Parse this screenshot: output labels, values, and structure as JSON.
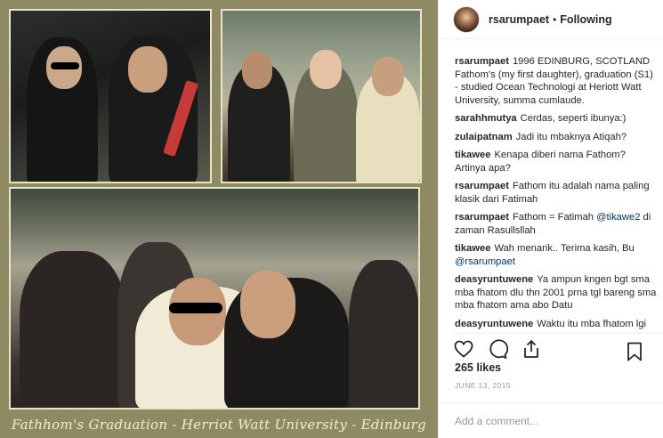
{
  "post": {
    "caption_overlay": "Fathhom's Graduation - Herriot Watt University - Edinburg"
  },
  "header": {
    "username": "rsarumpaet",
    "separator": "•",
    "follow_state": "Following"
  },
  "comments": [
    {
      "user": "rsarumpaet",
      "text": "1996 EDINBURG, SCOTLAND Fathom's (my first daughter), graduation (S1) - studied Ocean Technologi at Heriott Watt University, summa cumlaude."
    },
    {
      "user": "sarahhmutya",
      "text": "Cerdas, seperti ibunya:)"
    },
    {
      "user": "zulaipatnam",
      "text": "Jadi itu mbaknya Atiqah?"
    },
    {
      "user": "tikawee",
      "text": "Kenapa diberi nama Fathom? Artinya apa?"
    },
    {
      "user": "rsarumpaet",
      "text": "Fathom itu adalah nama paling klasik dari Fatimah"
    },
    {
      "user": "rsarumpaet",
      "text": "Fathom = Fatimah",
      "mention": "@tikawe2",
      "text_after": "di zaman Rasullsllah"
    },
    {
      "user": "tikawee",
      "text": "Wah menarik.. Terima kasih, Bu",
      "mention_newline": "@rsarumpaet"
    },
    {
      "user": "deasyruntuwene",
      "text": "Ya ampun kngen bgt sma mba fhatom dlu thn 2001 prna tgl bareng sma mba fhatom ama abo Datu"
    },
    {
      "user": "deasyruntuwene",
      "text": "Waktu itu mba fhatom lgi"
    }
  ],
  "actions": {
    "like_icon": "heart-icon",
    "comment_icon": "comment-icon",
    "share_icon": "share-icon",
    "save_icon": "bookmark-icon"
  },
  "likes": "265 likes",
  "date": "JUNE 13, 2015",
  "add_comment": {
    "placeholder": "Add a comment..."
  }
}
